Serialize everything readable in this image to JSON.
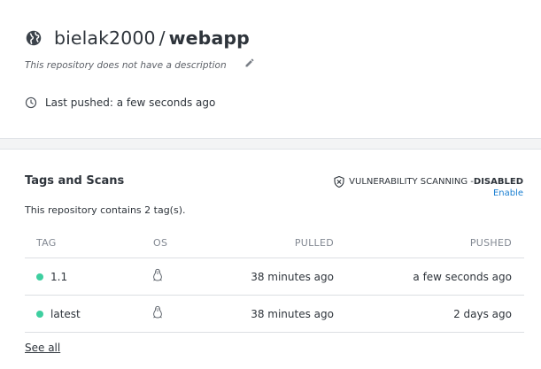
{
  "repo": {
    "namespace": "bielak2000",
    "separator": "/",
    "name": "webapp",
    "description": "This repository does not have a description",
    "last_pushed": "Last pushed: a few seconds ago"
  },
  "tags_section": {
    "title": "Tags and Scans",
    "vuln_label": "VULNERABILITY SCANNING - ",
    "vuln_status": "DISABLED",
    "enable_label": "Enable",
    "contains_text": "This repository contains 2 tag(s).",
    "columns": [
      "TAG",
      "OS",
      "PULLED",
      "PUSHED"
    ],
    "rows": [
      {
        "tag": "1.1",
        "os_icon": "linux-icon",
        "pulled": "38 minutes ago",
        "pushed": "a few seconds ago",
        "status_color": "#3ecfa0"
      },
      {
        "tag": "latest",
        "os_icon": "linux-icon",
        "pulled": "38 minutes ago",
        "pushed": "2 days ago",
        "status_color": "#3ecfa0"
      }
    ],
    "see_all_label": "See all"
  },
  "colors": {
    "accent": "#1a7fd1",
    "status_ok": "#3ecfa0"
  }
}
